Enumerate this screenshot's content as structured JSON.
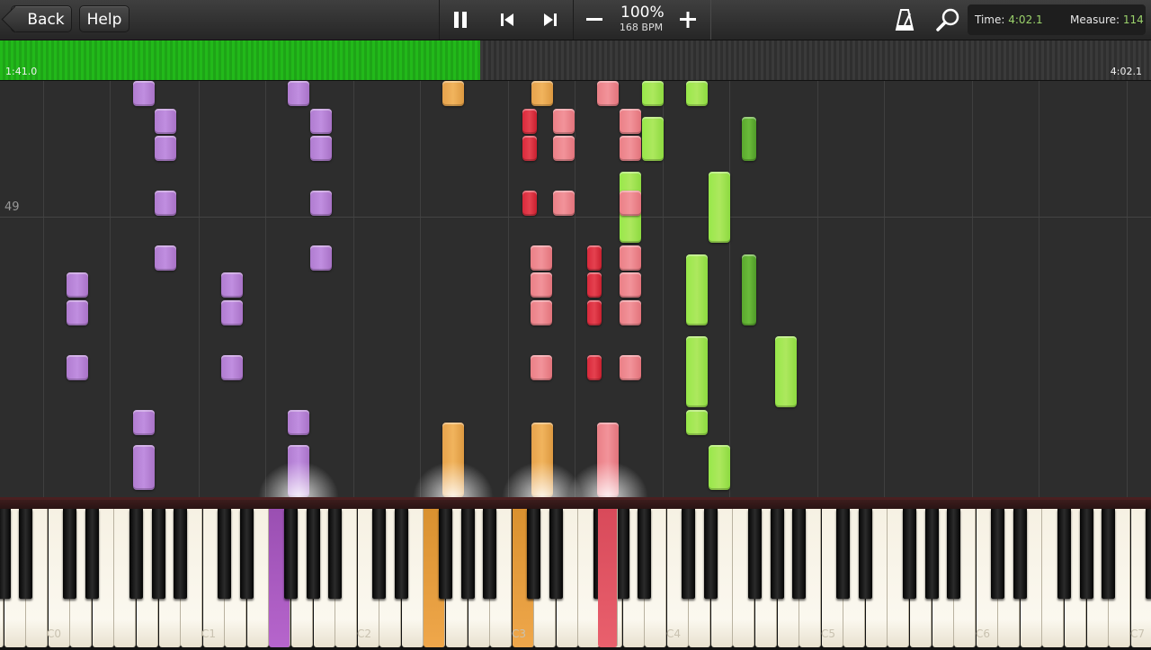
{
  "toolbar": {
    "back_label": "Back",
    "help_label": "Help",
    "speed_percent": "100%",
    "bpm": "168 BPM",
    "time_label": "Time:",
    "time_value": "4:02.1",
    "measure_label": "Measure:",
    "measure_value": "114",
    "icons": [
      "pause-icon",
      "skip-back-icon",
      "skip-forward-icon",
      "minus-icon",
      "plus-icon",
      "metronome-icon",
      "search-icon"
    ]
  },
  "progress": {
    "elapsed": "1:41.0",
    "total": "4:02.1",
    "fraction": 0.417,
    "color": "#22b91a"
  },
  "roll": {
    "measure_number": "49"
  },
  "keyboard": {
    "octave_labels": [
      "C0",
      "C1",
      "C2",
      "C3",
      "C4",
      "C5",
      "C6",
      "C7"
    ],
    "pressed_colors": {
      "purple": "#a85ec4",
      "orange": "#e69d3e",
      "pink": "#e05564"
    }
  },
  "colors": {
    "purple": "#b981d6",
    "orange": "#eaa653",
    "pink": "#ee8a91",
    "red": "#df3545",
    "lime": "#a4e653",
    "dark_green": "#62b234",
    "background": "#2d2d2d"
  }
}
